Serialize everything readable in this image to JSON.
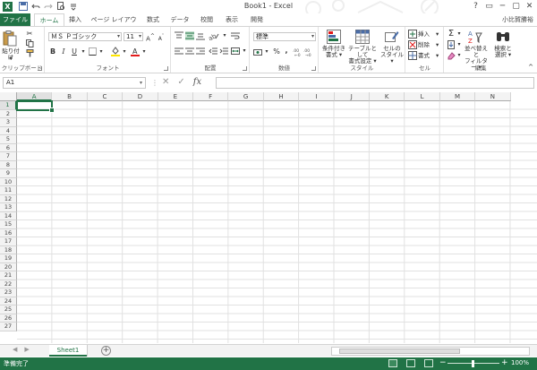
{
  "window": {
    "title": "Book1 - Excel",
    "app_icon": "X",
    "qat_icons": [
      "save-icon",
      "undo-icon",
      "redo-icon",
      "print-preview-icon",
      "customize-icon"
    ],
    "controls": [
      "?",
      "▭",
      "─",
      "▢",
      "✕"
    ]
  },
  "tabs": {
    "file": "ファイル",
    "items": [
      "ホーム",
      "挿入",
      "ページ レイアウト",
      "数式",
      "データ",
      "校閲",
      "表示",
      "開発"
    ],
    "active": "ホーム",
    "user": "小比賀勝裕"
  },
  "ribbon": {
    "clipboard": {
      "label": "クリップボード",
      "paste": "貼り付け"
    },
    "font": {
      "label": "フォント",
      "name": "ＭＳ Ｐゴシック",
      "size": "11",
      "bold": "B",
      "italic": "I",
      "underline": "U"
    },
    "alignment": {
      "label": "配置"
    },
    "number": {
      "label": "数値",
      "format": "標準",
      "percent": "%",
      "comma": ","
    },
    "styles": {
      "label": "スタイル",
      "conditional_line1": "条件付き",
      "conditional_line2": "書式",
      "table_line1": "テーブルとして",
      "table_line2": "書式設定",
      "cell_line1": "セルの",
      "cell_line2": "スタイル"
    },
    "cells": {
      "label": "セル",
      "insert": "挿入",
      "delete": "削除",
      "format": "書式"
    },
    "editing": {
      "label": "編集",
      "sort_line1": "並べ替えと",
      "sort_line2": "フィルター",
      "find_line1": "検索と",
      "find_line2": "選択"
    }
  },
  "formula_bar": {
    "name_box": "A1",
    "cancel": "✕",
    "enter": "✓",
    "fx": "fx",
    "value": ""
  },
  "grid": {
    "columns": [
      "A",
      "B",
      "C",
      "D",
      "E",
      "F",
      "G",
      "H",
      "I",
      "J",
      "K",
      "L",
      "M",
      "N"
    ],
    "rows": [
      "1",
      "2",
      "3",
      "4",
      "5",
      "6",
      "7",
      "8",
      "9",
      "10",
      "11",
      "12",
      "13",
      "14",
      "15",
      "16",
      "17",
      "18",
      "19",
      "20",
      "21",
      "22",
      "23",
      "24",
      "25",
      "26",
      "27"
    ],
    "active_cell": "A1"
  },
  "sheets": {
    "items": [
      "Sheet1"
    ],
    "active": "Sheet1",
    "nav_prev": "◀",
    "nav_next": "▶",
    "add": "+"
  },
  "status": {
    "text": "準備完了",
    "zoom_minus": "−",
    "zoom_plus": "+",
    "zoom": "100%"
  },
  "colors": {
    "accent": "#217346",
    "font_color_bar": "#e31b1b",
    "fill_color_bar": "#ffe600"
  }
}
